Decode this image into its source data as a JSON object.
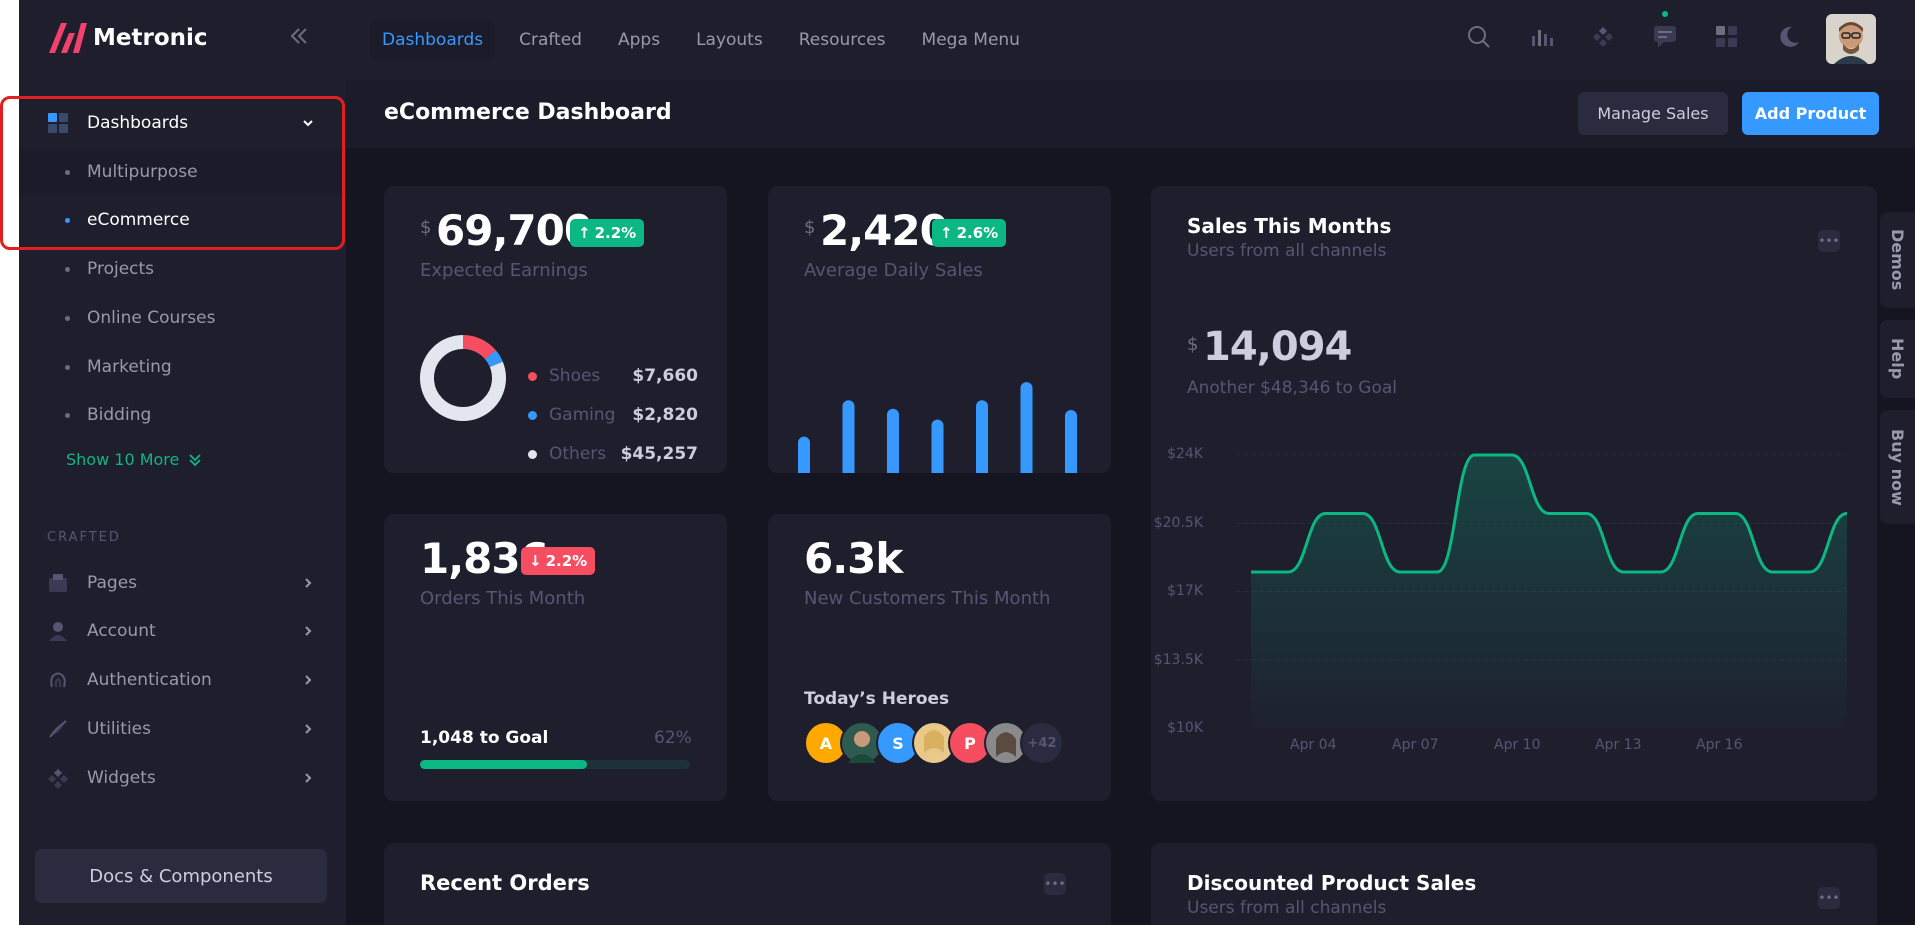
{
  "brand": {
    "name": "Metronic"
  },
  "sidebar": {
    "dashboards_label": "Dashboards",
    "sub_items": [
      "Multipurpose",
      "eCommerce",
      "Projects",
      "Online Courses",
      "Marketing",
      "Bidding"
    ],
    "show_more": "Show 10 More",
    "section_label": "CRAFTED",
    "crafted_items": [
      "Pages",
      "Account",
      "Authentication",
      "Utilities",
      "Widgets"
    ],
    "docs_button": "Docs & Components"
  },
  "header": {
    "menu": [
      "Dashboards",
      "Crafted",
      "Apps",
      "Layouts",
      "Resources",
      "Mega Menu"
    ]
  },
  "toolbar": {
    "title": "eCommerce Dashboard",
    "manage_sales": "Manage Sales",
    "add_product": "Add Product"
  },
  "earnings": {
    "currency": "$",
    "value": "69,700",
    "change": "2.2%",
    "label": "Expected Earnings",
    "breakdown": [
      {
        "name": "Shoes",
        "value": "$7,660",
        "color": "#f64e60"
      },
      {
        "name": "Gaming",
        "value": "$2,820",
        "color": "#3699ff"
      },
      {
        "name": "Others",
        "value": "$45,257",
        "color": "#e4e6ef"
      }
    ]
  },
  "daily_sales": {
    "currency": "$",
    "value": "2,420",
    "change": "2.6%",
    "label": "Average Daily Sales"
  },
  "orders": {
    "value": "1,836",
    "change": "2.2%",
    "label": "Orders This Month",
    "goal_label": "1,048 to Goal",
    "goal_percent": "62%",
    "progress": 0.62
  },
  "customers": {
    "value": "6.3k",
    "label": "New Customers This Month",
    "heroes_title": "Today’s Heroes",
    "heroes": [
      "A",
      "",
      "S",
      "",
      "P",
      "",
      "+42"
    ]
  },
  "sales_month": {
    "title": "Sales This Months",
    "subtitle": "Users from all channels",
    "currency": "$",
    "value": "14,094",
    "goal": "Another $48,346 to Goal"
  },
  "chart_data": [
    {
      "type": "donut",
      "categories": [
        "Shoes",
        "Gaming",
        "Others"
      ],
      "values": [
        7660,
        2820,
        45257
      ]
    },
    {
      "type": "bar",
      "values": [
        30,
        60,
        53,
        44,
        60,
        75,
        52
      ]
    },
    {
      "type": "area",
      "x": [
        "Apr 02",
        "Apr 03",
        "Apr 04",
        "Apr 05",
        "Apr 06",
        "Apr 07",
        "Apr 08",
        "Apr 09",
        "Apr 10",
        "Apr 11",
        "Apr 12",
        "Apr 13",
        "Apr 14",
        "Apr 15",
        "Apr 16",
        "Apr 17",
        "Apr 18"
      ],
      "values": [
        18000,
        18000,
        21000,
        21000,
        18000,
        18000,
        24000,
        24000,
        21000,
        21000,
        18000,
        18000,
        21000,
        21000,
        18000,
        18000,
        21000
      ],
      "x_ticks": [
        "Apr 04",
        "Apr 07",
        "Apr 10",
        "Apr 13",
        "Apr 16"
      ],
      "y_ticks": [
        "$24K",
        "$20.5K",
        "$17K",
        "$13.5K",
        "$10K"
      ],
      "ylim": [
        10000,
        24000
      ],
      "color": "#0bb783"
    }
  ],
  "recent_orders": {
    "title": "Recent Orders"
  },
  "discounted": {
    "title": "Discounted Product Sales",
    "subtitle": "Users from all channels"
  },
  "side_tabs": [
    "Demos",
    "Help",
    "Buy now"
  ],
  "colors": {
    "primary": "#3699ff",
    "success": "#0bb783",
    "danger": "#f64e60",
    "bg": "#151521",
    "card": "#1e1e2d"
  }
}
